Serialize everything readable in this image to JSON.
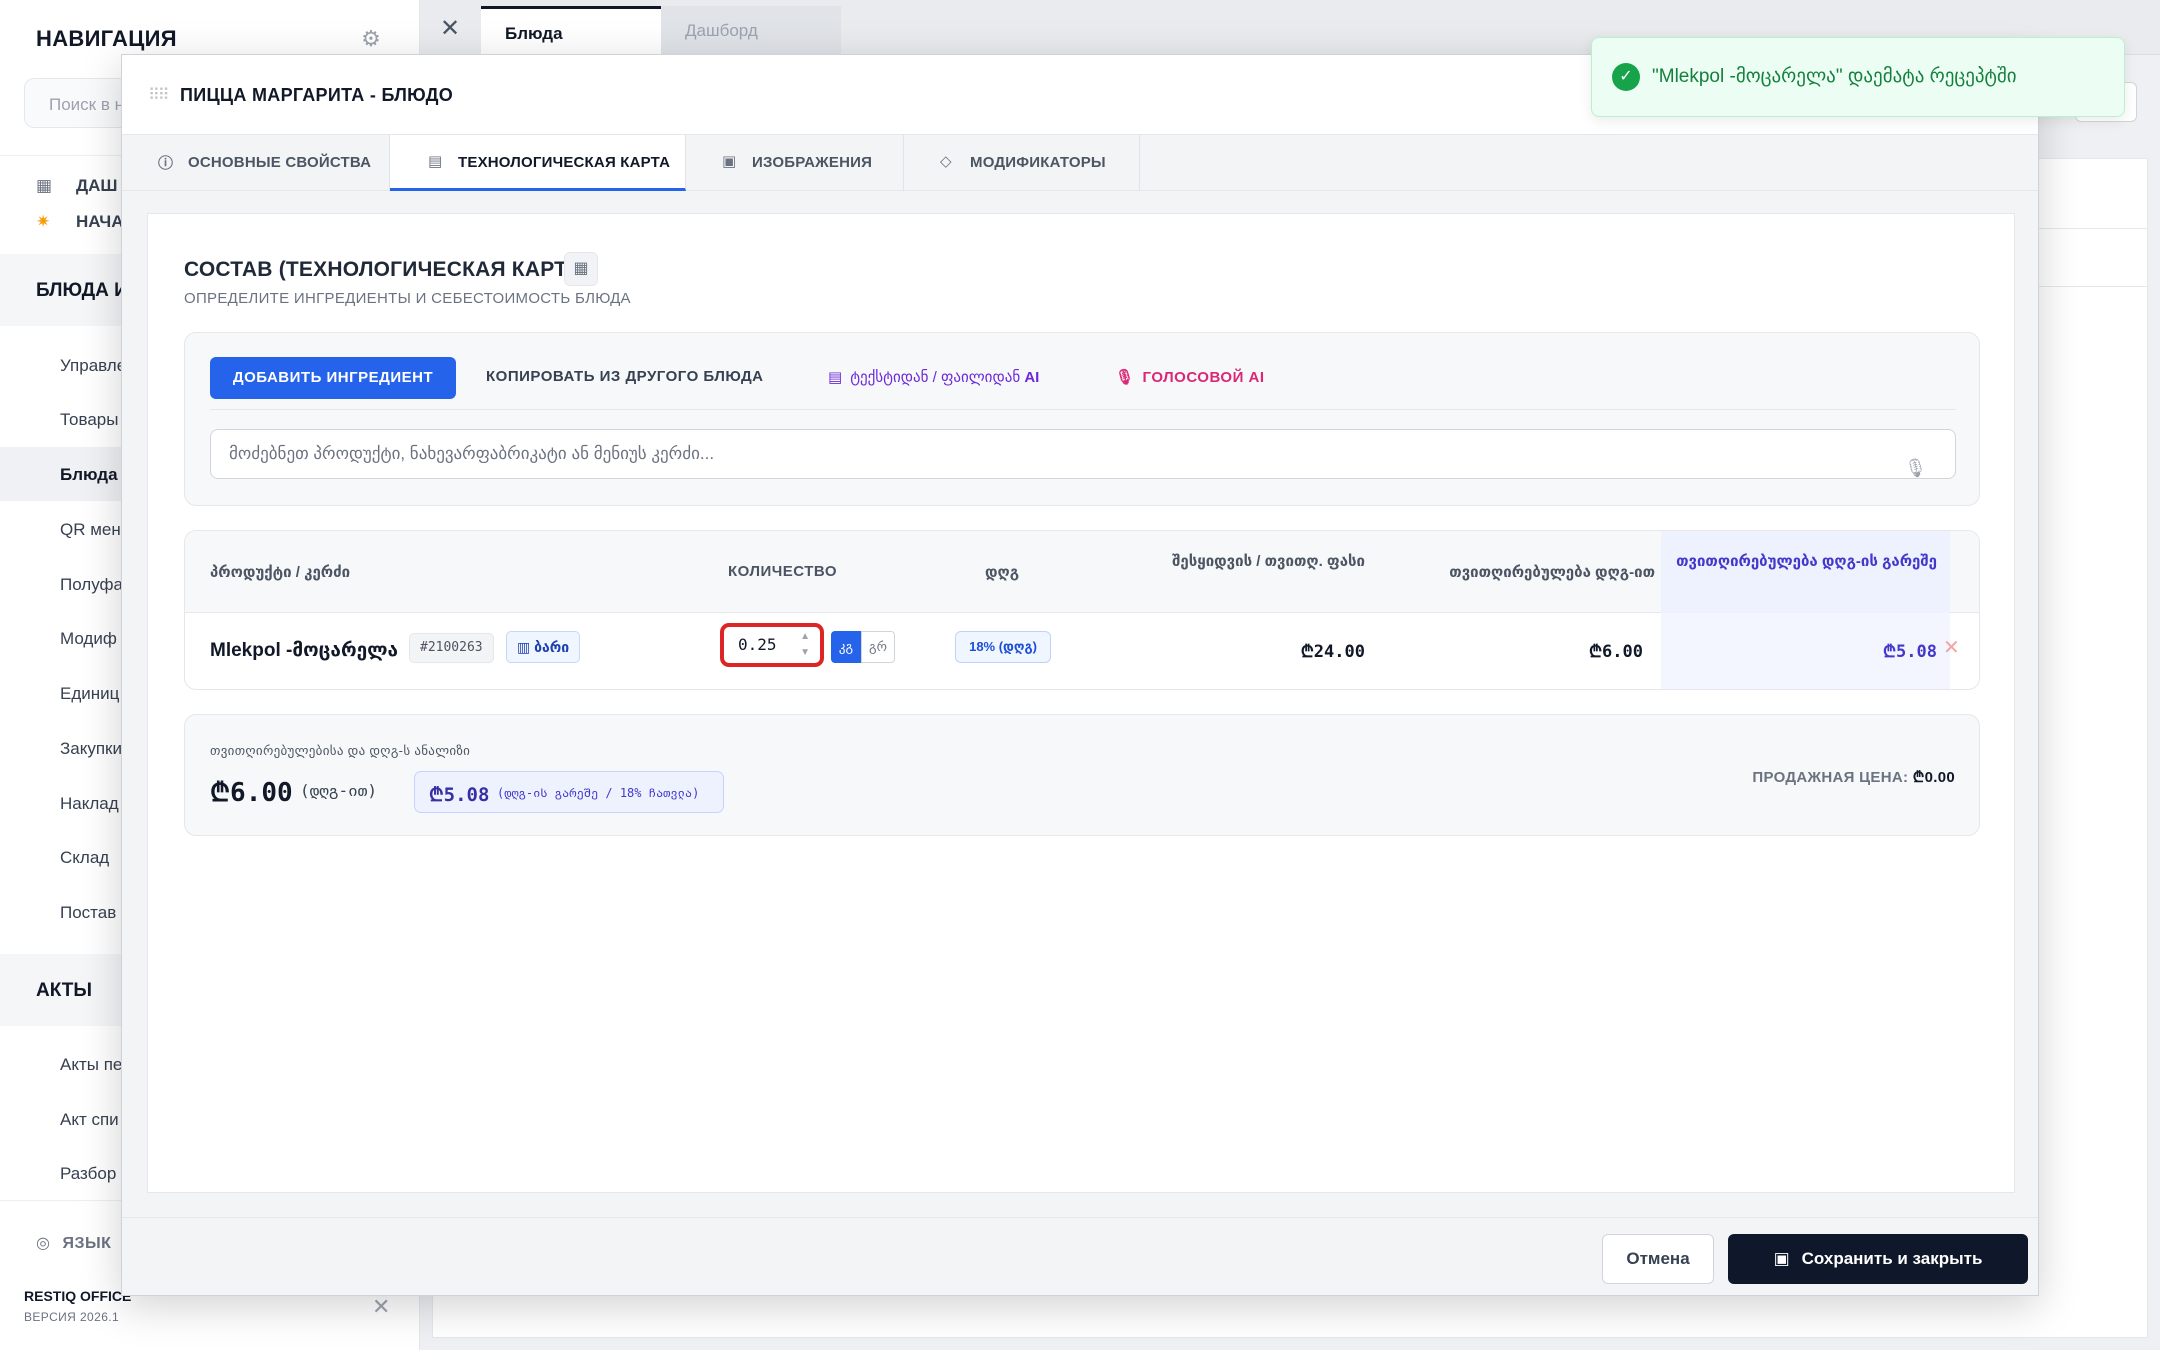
{
  "sidebar": {
    "title": "НАВИГАЦИЯ",
    "search_placeholder": "Поиск в н",
    "top_items": [
      {
        "label": "ДАШ",
        "icon": "dashboard-icon"
      },
      {
        "label": "НАЧА",
        "icon": "sparkles-icon"
      }
    ],
    "section1": "БЛЮДА И",
    "items": [
      "Управле",
      "Товары",
      "Блюда",
      "QR мен",
      "Полуфа",
      "Модиф",
      "Единиц",
      "Закупки",
      "Наклад",
      "Склад",
      "Постав"
    ],
    "active_item": "Блюда",
    "section2": "АКТЫ",
    "items2": [
      "Акты пе",
      "Акт спи",
      "Разбор"
    ],
    "lang_label": "ЯЗЫК",
    "brand": "RESTIQ OFFICE",
    "version": "ВЕРСИЯ 2026.1"
  },
  "page_tabs": [
    {
      "label": "Блюда",
      "active": true
    },
    {
      "label": "Дашборд",
      "active": false
    }
  ],
  "modal": {
    "title": "ПИЦЦА МАРГАРИТА - БЛЮДО",
    "tabs": [
      {
        "label": "ОСНОВНЫЕ СВОЙСТВА",
        "icon": "info-icon"
      },
      {
        "label": "ТЕХНОЛОГИЧЕСКАЯ КАРТА",
        "icon": "document-icon"
      },
      {
        "label": "ИЗОБРАЖЕНИЯ",
        "icon": "image-icon"
      },
      {
        "label": "МОДИФИКАТОРЫ",
        "icon": "tag-icon"
      }
    ],
    "active_tab": "ТЕХНОЛОГИЧЕСКАЯ КАРТА",
    "section_title": "СОСТАВ (ТЕХНОЛОГИЧЕСКАЯ КАРТА)",
    "section_subtitle": "ОПРЕДЕЛИТЕ ИНГРЕДИЕНТЫ И СЕБЕСТОИМОСТЬ БЛЮДА",
    "actions": {
      "add_ingredient": "ДОБАВИТЬ ИНГРЕДИЕНТ",
      "copy_from_dish": "КОПИРОВАТЬ ИЗ ДРУГОГО БЛЮДА",
      "ai_from_text": "ტექსტიდან / ფაილიდან",
      "ai_label": "AI",
      "voice_ai": "ГОЛОСОВОЙ AI",
      "search_placeholder": "მოძებნეთ პროდუქტი, ნახევარფაბრიკატი ან მენიუს კერძი..."
    },
    "table": {
      "headers": {
        "product": "პროდუქტი / კერძი",
        "quantity": "КОЛИЧЕСТВО",
        "vat": "დღგ",
        "purchase_price": "შესყიდვის / თვითღ. ფასი",
        "cost_with_vat": "თვითღირებულება დღგ-ით",
        "cost_without_vat": "თვითღირებულება დღგ-ის გარეშე"
      },
      "rows": [
        {
          "name": "Mlekpol -მოცარელა",
          "code": "#2100263",
          "warehouse": "ბარი",
          "quantity": "0.25",
          "unit_kg": "კგ",
          "unit_gr": "გრ",
          "vat": "18% (დღგ)",
          "purchase_price": "₾24.00",
          "cost_with_vat": "₾6.00",
          "cost_without_vat": "₾5.08"
        }
      ]
    },
    "summary": {
      "label": "თვითღირებულებისა და დღგ-ს ანალიზი",
      "total_with_vat": "₾6.00",
      "total_with_vat_note": "(დღგ-ით)",
      "total_without_vat": "₾5.08",
      "total_without_vat_note": "(დღგ-ის გარეშე / 18% ჩათვლა)",
      "sale_price_label": "ПРОДАЖНАЯ ЦЕНА:",
      "sale_price_value": "₾0.00"
    },
    "footer": {
      "cancel": "Отмена",
      "save": "Сохранить и закрыть"
    }
  },
  "toast": {
    "message": "\"Mlekpol -მოცარელა\" დაემატა რეცეპტში"
  },
  "colors": {
    "accent": "#2563eb",
    "danger_highlight": "#dc2626",
    "success": "#16a34a",
    "primary_dark": "#0f172a"
  }
}
